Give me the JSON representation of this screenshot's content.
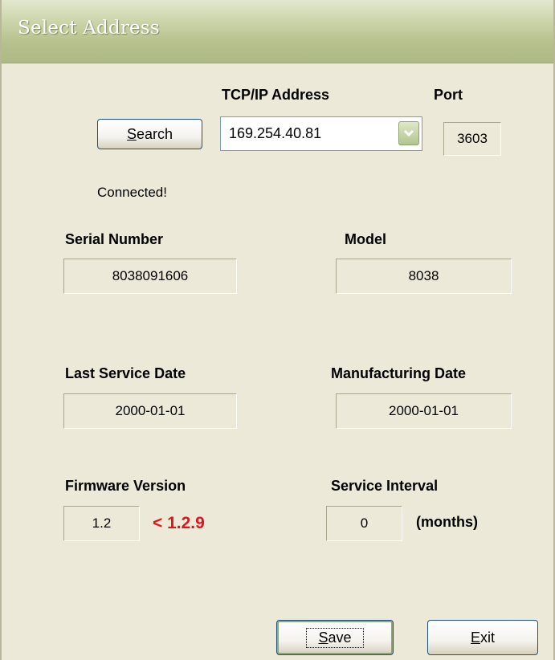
{
  "window": {
    "title": "Select Address"
  },
  "connection": {
    "address_header": "TCP/IP Address",
    "port_header": "Port",
    "search_button": {
      "before": "",
      "accel": "S",
      "after": "earch"
    },
    "address_value": "169.254.40.81",
    "port_value": "3603",
    "status": "Connected!"
  },
  "device": {
    "serial_label": "Serial Number",
    "serial_value": "8038091606",
    "model_label": "Model",
    "model_value": "8038",
    "last_service_label": "Last Service Date",
    "last_service_value": "2000-01-01",
    "manufacturing_label": "Manufacturing Date",
    "manufacturing_value": "2000-01-01",
    "firmware_label": "Firmware Version",
    "firmware_value": "1.2",
    "firmware_warning": "< 1.2.9",
    "service_interval_label": "Service Interval",
    "service_interval_value": "0",
    "service_interval_unit": "(months)"
  },
  "actions": {
    "save_button": {
      "accel": "S",
      "after": "ave"
    },
    "exit_button": {
      "accel": "E",
      "after": "xit"
    }
  },
  "colors": {
    "warning": "#e0141c",
    "titlebar": "#b5c08c",
    "background": "#ece9d8"
  }
}
